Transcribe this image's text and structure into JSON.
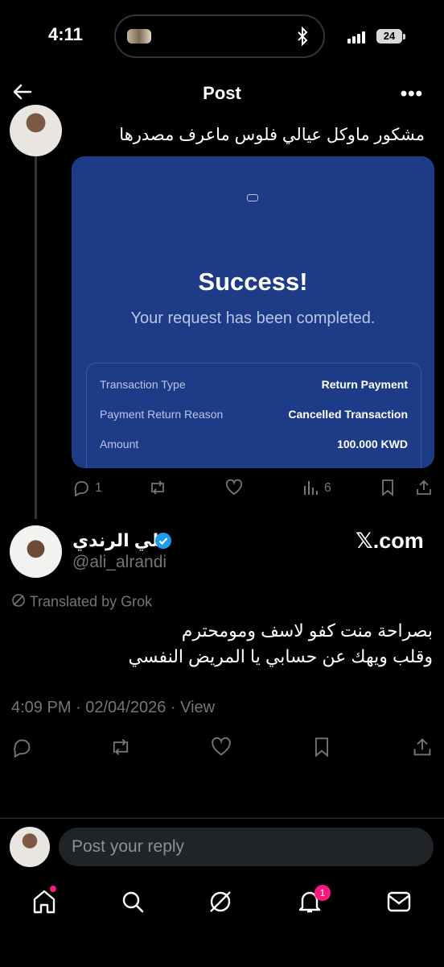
{
  "status_bar": {
    "time": "4:11",
    "battery": "24"
  },
  "header": {
    "title": "Post"
  },
  "parent_tweet": {
    "text": "مشكور ماوكل عيالي فلوس ماعرف مصدرها",
    "card": {
      "title": "Success!",
      "subtitle": "Your request has been completed.",
      "rows": [
        {
          "label": "Transaction Type",
          "value": "Return Payment"
        },
        {
          "label": "Payment Return Reason",
          "value": "Cancelled Transaction"
        },
        {
          "label": "Amount",
          "value": "100.000 KWD"
        }
      ]
    },
    "actions": {
      "replies": "1",
      "views": "6"
    }
  },
  "main_post": {
    "name": "علي الرندي",
    "handle": "@ali_alrandi",
    "source": "𝕏.com",
    "translated_label": "Translated by Grok",
    "text_line1": "بصراحة منت كفو لاسف وموم‍حترم",
    "text_line2": "وقلب ويهك عن حسابي يا المريض النفسي",
    "meta": "4:09 PM · 02/04/2026 · View"
  },
  "reply": {
    "placeholder": "Post your reply"
  },
  "bottom_nav": {
    "notifications_badge": "1"
  },
  "colors": {
    "card": "#1d3b86",
    "accent": "#1d9bf0",
    "badge": "#f91880"
  }
}
